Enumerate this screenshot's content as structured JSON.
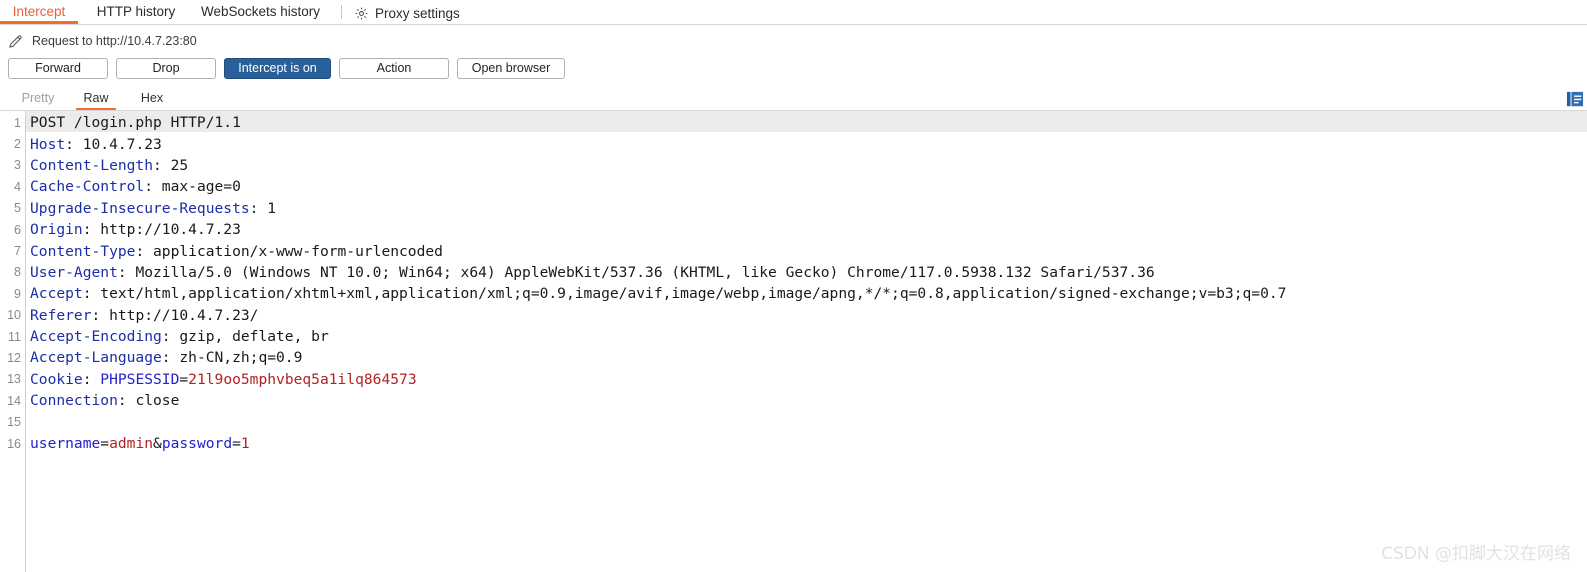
{
  "tabs": {
    "items": [
      {
        "id": "intercept",
        "label": "Intercept",
        "active": true
      },
      {
        "id": "http-history",
        "label": "HTTP history",
        "active": false
      },
      {
        "id": "websockets-history",
        "label": "WebSockets history",
        "active": false
      }
    ],
    "proxy_settings_label": "Proxy settings",
    "proxy_settings_icon": "gear-icon",
    "active_accent": "#f26c37"
  },
  "request_bar": {
    "edit_icon": "pencil-icon",
    "label": "Request to http://10.4.7.23:80"
  },
  "toolbar": {
    "forward_label": "Forward",
    "drop_label": "Drop",
    "intercept_toggle_label": "Intercept is on",
    "intercept_toggle_active": true,
    "intercept_toggle_color": "#2a6099",
    "action_label": "Action",
    "open_browser_label": "Open browser"
  },
  "view_tabs": {
    "items": [
      {
        "id": "pretty",
        "label": "Pretty",
        "active": false,
        "enabled": false
      },
      {
        "id": "raw",
        "label": "Raw",
        "active": true,
        "enabled": true
      },
      {
        "id": "hex",
        "label": "Hex",
        "active": false,
        "enabled": true
      }
    ],
    "inspector_icon": "inspector-panel-icon"
  },
  "editor": {
    "highlighted_line": 1,
    "lines": [
      {
        "n": 1,
        "segments": [
          {
            "t": "POST /login.php HTTP/1.1",
            "c": "v"
          }
        ]
      },
      {
        "n": 2,
        "segments": [
          {
            "t": "Host",
            "c": "k"
          },
          {
            "t": ": 10.4.7.23",
            "c": "v"
          }
        ]
      },
      {
        "n": 3,
        "segments": [
          {
            "t": "Content-Length",
            "c": "k"
          },
          {
            "t": ": 25",
            "c": "v"
          }
        ]
      },
      {
        "n": 4,
        "segments": [
          {
            "t": "Cache-Control",
            "c": "k"
          },
          {
            "t": ": max-age=0",
            "c": "v"
          }
        ]
      },
      {
        "n": 5,
        "segments": [
          {
            "t": "Upgrade-Insecure-Requests",
            "c": "k"
          },
          {
            "t": ": 1",
            "c": "v"
          }
        ]
      },
      {
        "n": 6,
        "segments": [
          {
            "t": "Origin",
            "c": "k"
          },
          {
            "t": ": http://10.4.7.23",
            "c": "v"
          }
        ]
      },
      {
        "n": 7,
        "segments": [
          {
            "t": "Content-Type",
            "c": "k"
          },
          {
            "t": ": application/x-www-form-urlencoded",
            "c": "v"
          }
        ]
      },
      {
        "n": 8,
        "segments": [
          {
            "t": "User-Agent",
            "c": "k"
          },
          {
            "t": ": Mozilla/5.0 (Windows NT 10.0; Win64; x64) AppleWebKit/537.36 (KHTML, like Gecko) Chrome/117.0.5938.132 Safari/537.36",
            "c": "v"
          }
        ]
      },
      {
        "n": 9,
        "segments": [
          {
            "t": "Accept",
            "c": "k"
          },
          {
            "t": ": text/html,application/xhtml+xml,application/xml;q=0.9,image/avif,image/webp,image/apng,*/*;q=0.8,application/signed-exchange;v=b3;q=0.7",
            "c": "v"
          }
        ]
      },
      {
        "n": 10,
        "segments": [
          {
            "t": "Referer",
            "c": "k"
          },
          {
            "t": ": http://10.4.7.23/",
            "c": "v"
          }
        ]
      },
      {
        "n": 11,
        "segments": [
          {
            "t": "Accept-Encoding",
            "c": "k"
          },
          {
            "t": ": gzip, deflate, br",
            "c": "v"
          }
        ]
      },
      {
        "n": 12,
        "segments": [
          {
            "t": "Accept-Language",
            "c": "k"
          },
          {
            "t": ": zh-CN,zh;q=0.9",
            "c": "v"
          }
        ]
      },
      {
        "n": 13,
        "segments": [
          {
            "t": "Cookie",
            "c": "k"
          },
          {
            "t": ": ",
            "c": "v"
          },
          {
            "t": "PHPSESSID",
            "c": "kb"
          },
          {
            "t": "=",
            "c": "v"
          },
          {
            "t": "21l9oo5mphvbeq5a1ilq864573",
            "c": "r"
          }
        ]
      },
      {
        "n": 14,
        "segments": [
          {
            "t": "Connection",
            "c": "k"
          },
          {
            "t": ": close",
            "c": "v"
          }
        ]
      },
      {
        "n": 15,
        "segments": []
      },
      {
        "n": 16,
        "segments": [
          {
            "t": "username",
            "c": "kb"
          },
          {
            "t": "=",
            "c": "v"
          },
          {
            "t": "admin",
            "c": "r"
          },
          {
            "t": "&",
            "c": "amp"
          },
          {
            "t": "password",
            "c": "kb"
          },
          {
            "t": "=",
            "c": "v"
          },
          {
            "t": "1",
            "c": "r"
          }
        ]
      }
    ]
  },
  "watermark": {
    "text": "CSDN @扣脚大汉在网络"
  }
}
